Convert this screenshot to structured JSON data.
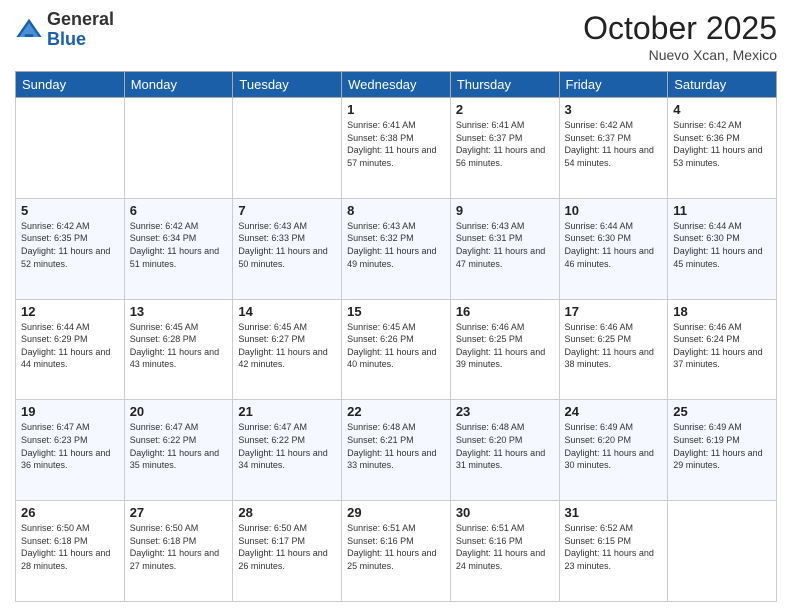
{
  "header": {
    "logo_general": "General",
    "logo_blue": "Blue",
    "month": "October 2025",
    "location": "Nuevo Xcan, Mexico"
  },
  "days_of_week": [
    "Sunday",
    "Monday",
    "Tuesday",
    "Wednesday",
    "Thursday",
    "Friday",
    "Saturday"
  ],
  "weeks": [
    [
      {
        "day": "",
        "info": ""
      },
      {
        "day": "",
        "info": ""
      },
      {
        "day": "",
        "info": ""
      },
      {
        "day": "1",
        "info": "Sunrise: 6:41 AM\nSunset: 6:38 PM\nDaylight: 11 hours and 57 minutes."
      },
      {
        "day": "2",
        "info": "Sunrise: 6:41 AM\nSunset: 6:37 PM\nDaylight: 11 hours and 56 minutes."
      },
      {
        "day": "3",
        "info": "Sunrise: 6:42 AM\nSunset: 6:37 PM\nDaylight: 11 hours and 54 minutes."
      },
      {
        "day": "4",
        "info": "Sunrise: 6:42 AM\nSunset: 6:36 PM\nDaylight: 11 hours and 53 minutes."
      }
    ],
    [
      {
        "day": "5",
        "info": "Sunrise: 6:42 AM\nSunset: 6:35 PM\nDaylight: 11 hours and 52 minutes."
      },
      {
        "day": "6",
        "info": "Sunrise: 6:42 AM\nSunset: 6:34 PM\nDaylight: 11 hours and 51 minutes."
      },
      {
        "day": "7",
        "info": "Sunrise: 6:43 AM\nSunset: 6:33 PM\nDaylight: 11 hours and 50 minutes."
      },
      {
        "day": "8",
        "info": "Sunrise: 6:43 AM\nSunset: 6:32 PM\nDaylight: 11 hours and 49 minutes."
      },
      {
        "day": "9",
        "info": "Sunrise: 6:43 AM\nSunset: 6:31 PM\nDaylight: 11 hours and 47 minutes."
      },
      {
        "day": "10",
        "info": "Sunrise: 6:44 AM\nSunset: 6:30 PM\nDaylight: 11 hours and 46 minutes."
      },
      {
        "day": "11",
        "info": "Sunrise: 6:44 AM\nSunset: 6:30 PM\nDaylight: 11 hours and 45 minutes."
      }
    ],
    [
      {
        "day": "12",
        "info": "Sunrise: 6:44 AM\nSunset: 6:29 PM\nDaylight: 11 hours and 44 minutes."
      },
      {
        "day": "13",
        "info": "Sunrise: 6:45 AM\nSunset: 6:28 PM\nDaylight: 11 hours and 43 minutes."
      },
      {
        "day": "14",
        "info": "Sunrise: 6:45 AM\nSunset: 6:27 PM\nDaylight: 11 hours and 42 minutes."
      },
      {
        "day": "15",
        "info": "Sunrise: 6:45 AM\nSunset: 6:26 PM\nDaylight: 11 hours and 40 minutes."
      },
      {
        "day": "16",
        "info": "Sunrise: 6:46 AM\nSunset: 6:25 PM\nDaylight: 11 hours and 39 minutes."
      },
      {
        "day": "17",
        "info": "Sunrise: 6:46 AM\nSunset: 6:25 PM\nDaylight: 11 hours and 38 minutes."
      },
      {
        "day": "18",
        "info": "Sunrise: 6:46 AM\nSunset: 6:24 PM\nDaylight: 11 hours and 37 minutes."
      }
    ],
    [
      {
        "day": "19",
        "info": "Sunrise: 6:47 AM\nSunset: 6:23 PM\nDaylight: 11 hours and 36 minutes."
      },
      {
        "day": "20",
        "info": "Sunrise: 6:47 AM\nSunset: 6:22 PM\nDaylight: 11 hours and 35 minutes."
      },
      {
        "day": "21",
        "info": "Sunrise: 6:47 AM\nSunset: 6:22 PM\nDaylight: 11 hours and 34 minutes."
      },
      {
        "day": "22",
        "info": "Sunrise: 6:48 AM\nSunset: 6:21 PM\nDaylight: 11 hours and 33 minutes."
      },
      {
        "day": "23",
        "info": "Sunrise: 6:48 AM\nSunset: 6:20 PM\nDaylight: 11 hours and 31 minutes."
      },
      {
        "day": "24",
        "info": "Sunrise: 6:49 AM\nSunset: 6:20 PM\nDaylight: 11 hours and 30 minutes."
      },
      {
        "day": "25",
        "info": "Sunrise: 6:49 AM\nSunset: 6:19 PM\nDaylight: 11 hours and 29 minutes."
      }
    ],
    [
      {
        "day": "26",
        "info": "Sunrise: 6:50 AM\nSunset: 6:18 PM\nDaylight: 11 hours and 28 minutes."
      },
      {
        "day": "27",
        "info": "Sunrise: 6:50 AM\nSunset: 6:18 PM\nDaylight: 11 hours and 27 minutes."
      },
      {
        "day": "28",
        "info": "Sunrise: 6:50 AM\nSunset: 6:17 PM\nDaylight: 11 hours and 26 minutes."
      },
      {
        "day": "29",
        "info": "Sunrise: 6:51 AM\nSunset: 6:16 PM\nDaylight: 11 hours and 25 minutes."
      },
      {
        "day": "30",
        "info": "Sunrise: 6:51 AM\nSunset: 6:16 PM\nDaylight: 11 hours and 24 minutes."
      },
      {
        "day": "31",
        "info": "Sunrise: 6:52 AM\nSunset: 6:15 PM\nDaylight: 11 hours and 23 minutes."
      },
      {
        "day": "",
        "info": ""
      }
    ]
  ]
}
